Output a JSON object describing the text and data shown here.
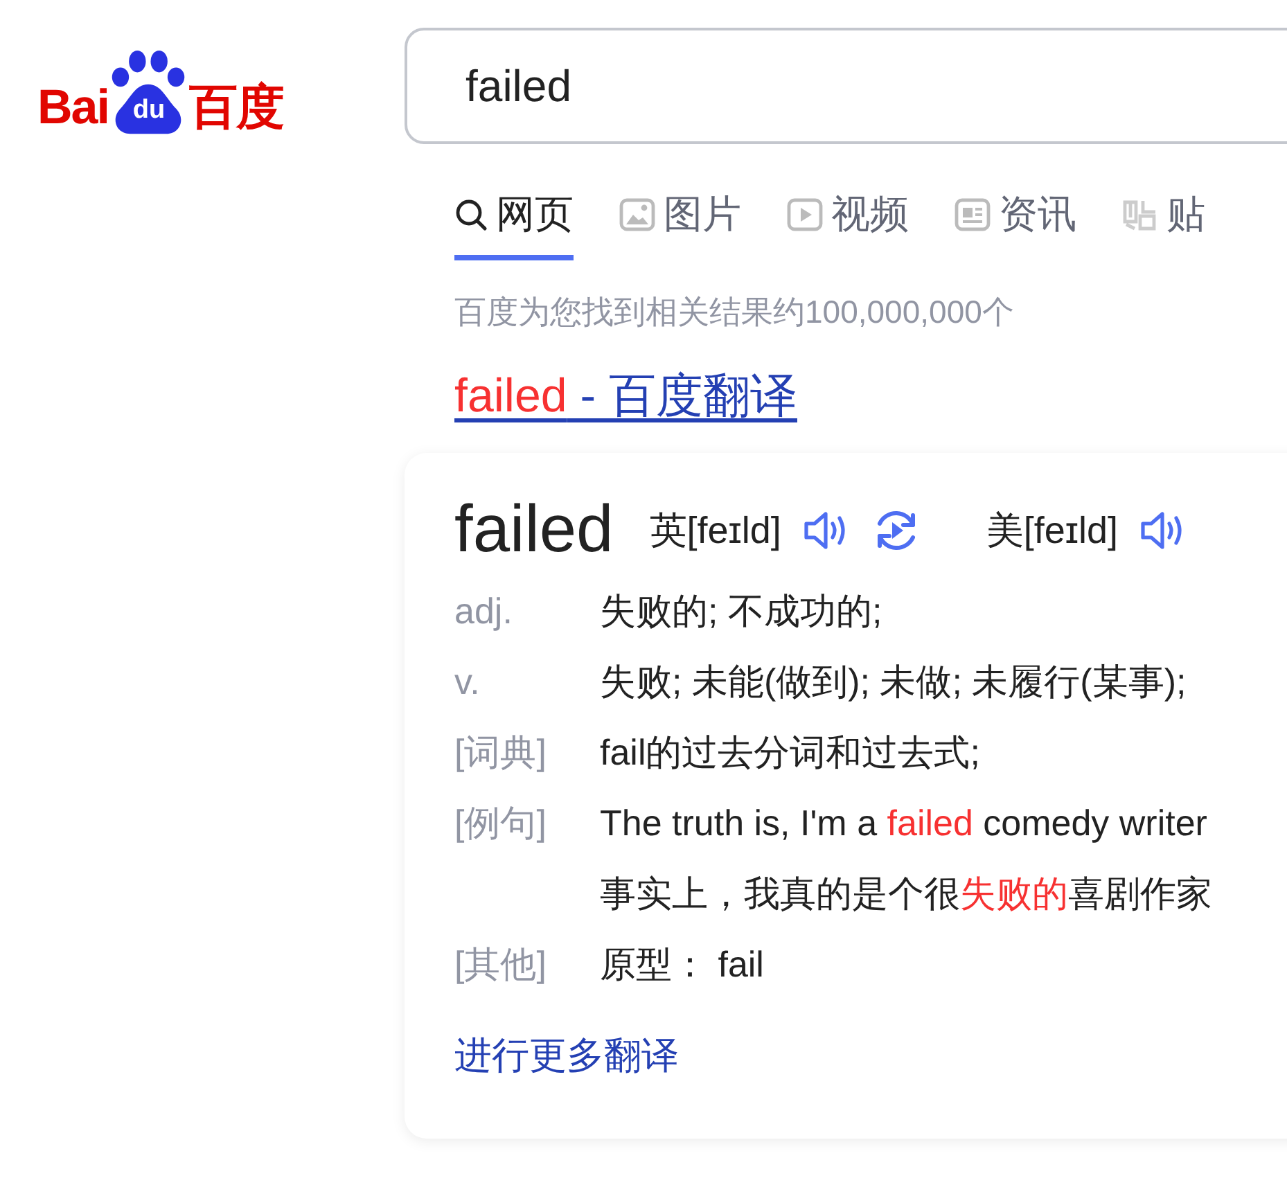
{
  "logo": {
    "left": "Bai",
    "paw": "du",
    "right": "百度"
  },
  "search": {
    "value": "failed"
  },
  "tabs": [
    {
      "kind": "search",
      "label": "网页",
      "selected": true
    },
    {
      "kind": "image",
      "label": "图片",
      "selected": false
    },
    {
      "kind": "video",
      "label": "视频",
      "selected": false
    },
    {
      "kind": "news",
      "label": "资讯",
      "selected": false
    },
    {
      "kind": "tieba",
      "label": "贴",
      "selected": false
    }
  ],
  "result_count": "百度为您找到相关结果约100,000,000个",
  "result_title": [
    {
      "text": "failed",
      "highlight": true
    },
    {
      "text": " - 百度翻译",
      "highlight": false
    }
  ],
  "card": {
    "headword": "failed",
    "pronunciations": [
      {
        "label": "英[feɪld]",
        "replay": true
      },
      {
        "label": "美[feɪld]",
        "replay": false
      }
    ],
    "rows": [
      {
        "label": "adj.",
        "lines": [
          [
            {
              "text": "失败的; 不成功的;",
              "highlight": false
            }
          ]
        ]
      },
      {
        "label": "v.",
        "lines": [
          [
            {
              "text": "失败; 未能(做到); 未做; 未履行(某事);",
              "highlight": false
            }
          ]
        ]
      },
      {
        "label": "[词典]",
        "lines": [
          [
            {
              "text": "fail的过去分词和过去式;",
              "highlight": false
            }
          ]
        ]
      },
      {
        "label": "[例句]",
        "lines": [
          [
            {
              "text": "The truth is, I'm a ",
              "highlight": false
            },
            {
              "text": "failed",
              "highlight": true
            },
            {
              "text": " comedy writer",
              "highlight": false
            }
          ],
          [
            {
              "text": "事实上，我真的是个很",
              "highlight": false
            },
            {
              "text": "失败的",
              "highlight": true
            },
            {
              "text": "喜剧作家",
              "highlight": false
            }
          ]
        ]
      },
      {
        "label": "[其他]",
        "lines": [
          [
            {
              "text": "原型： fail",
              "highlight": false
            }
          ]
        ]
      }
    ],
    "more_link": "进行更多翻译"
  }
}
